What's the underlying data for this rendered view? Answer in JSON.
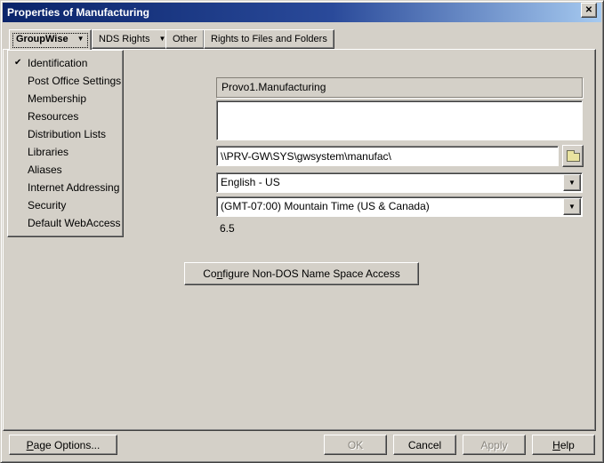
{
  "window": {
    "title": "Properties of Manufacturing",
    "close_icon": "✕"
  },
  "tabs": {
    "dropdown_arrow": "▼",
    "groupwise": {
      "label": "GroupWise"
    },
    "nds_rights": {
      "label": "NDS Rights"
    },
    "other": {
      "label": "Other"
    },
    "rights_files_folders": {
      "label": "Rights to Files and Folders"
    }
  },
  "menu": {
    "check_icon": "✔",
    "items": [
      {
        "label": "Identification",
        "checked": true
      },
      {
        "label": "Post Office Settings",
        "checked": false
      },
      {
        "label": "Membership",
        "checked": false
      },
      {
        "label": "Resources",
        "checked": false
      },
      {
        "label": "Distribution Lists",
        "checked": false
      },
      {
        "label": "Libraries",
        "checked": false
      },
      {
        "label": "Aliases",
        "checked": false
      },
      {
        "label": "Internet Addressing",
        "checked": false
      },
      {
        "label": "Security",
        "checked": false
      },
      {
        "label": "Default WebAccess",
        "checked": false
      }
    ]
  },
  "form": {
    "name_value": "Provo1.Manufacturing",
    "description_value": "",
    "unc_path_value": "\\\\PRV-GW\\SYS\\gwsystem\\manufac\\",
    "language_value": "English - US",
    "timezone_value": "(GMT-07:00) Mountain Time (US & Canada)",
    "version_value": "6.5",
    "configure_button": {
      "label": "Configure Non-DOS Name Space Access",
      "accel": 2
    }
  },
  "footer": {
    "page_options": {
      "label": "Page Options...",
      "accel": 0
    },
    "ok": {
      "label": "OK",
      "accel": -1
    },
    "cancel": {
      "label": "Cancel",
      "accel": -1
    },
    "apply": {
      "label": "Apply",
      "accel": -1
    },
    "help": {
      "label": "Help",
      "accel": 0
    }
  },
  "colors": {
    "dialog_bg": "#d4d0c8",
    "titlebar_gradient_start": "#0a246a",
    "titlebar_gradient_end": "#a6caf0",
    "title_text": "#ffffff",
    "field_bg": "#ffffff",
    "disabled_text": "#8a867e",
    "folder_icon_yellow": "#e9e3a0"
  }
}
